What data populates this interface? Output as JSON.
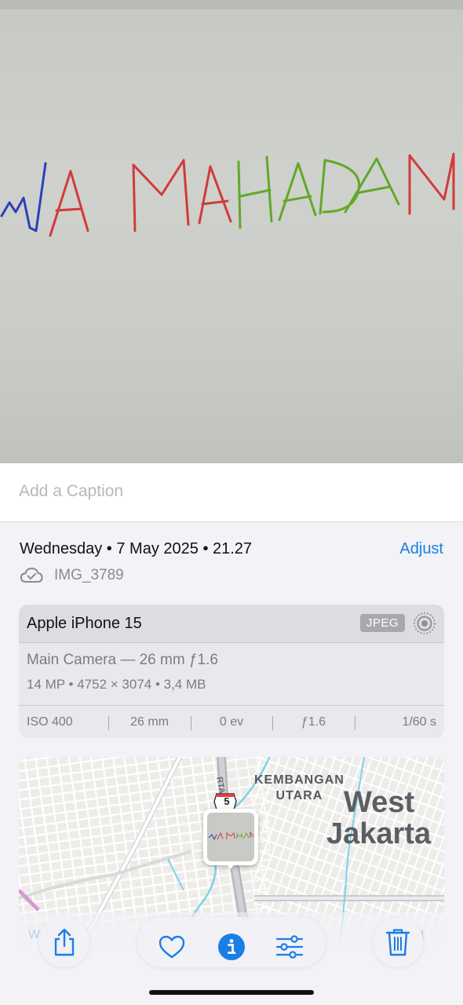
{
  "photo": {
    "scribble_text": "WA MAHADAN"
  },
  "caption": {
    "placeholder": "Add a Caption"
  },
  "info": {
    "datetime": "Wednesday • 7 May 2025 • 21.27",
    "adjust_label": "Adjust",
    "filename": "IMG_3789"
  },
  "camera": {
    "device": "Apple iPhone 15",
    "format_badge": "JPEG",
    "lens": "Main Camera — 26 mm ƒ1.6",
    "specs": "14 MP  •  4752 × 3074  •  3,4 MB",
    "exif": [
      "ISO 400",
      "26 mm",
      "0 ev",
      "ƒ1.6",
      "1/60 s"
    ]
  },
  "map": {
    "area_small": [
      "KEMBANGAN",
      "UTARA"
    ],
    "area_large": [
      "West",
      "Jakarta"
    ],
    "road_number": "5",
    "road_label": "RTA"
  },
  "toolbar": {
    "blurred_left": "W  arta  •",
    "blurred_right": "t"
  },
  "colors": {
    "accent": "#1a7ee6",
    "ink_blue": "#2f3fb8",
    "ink_red": "#d23a3a",
    "ink_green": "#62a82a"
  }
}
